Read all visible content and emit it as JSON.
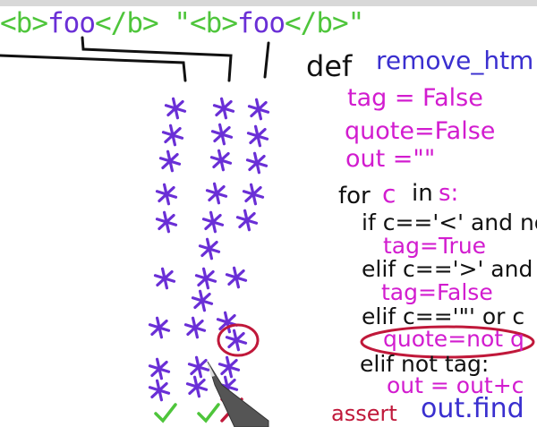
{
  "top_html": {
    "open1": "<b>",
    "text1": "foo",
    "close1": "</b>",
    "quote_open": "\"",
    "open2": "<b>",
    "text2": "foo",
    "close2": "</b>",
    "quote_close": "\""
  },
  "code": {
    "def_kw": "def",
    "fn_name": "remove_htm",
    "tag_line": "tag = False",
    "quote_line": "quote=False",
    "out_line": "out =\"\"",
    "for_kw": "for",
    "for_var": "c",
    "for_in": "in",
    "for_s": "s:",
    "if1": "if c=='<' and not",
    "tag_true": "tag=True",
    "elif2": "elif c=='>' and n",
    "tag_false": "tag=False",
    "elif3": "elif c=='\"' or c",
    "quote_not": "quote=not q",
    "elif4": "elif not tag:",
    "out_plus": "out = out+c",
    "assert_kw": "assert",
    "assert_expr": "out.find"
  },
  "annotations": {
    "asterisk": "*",
    "check": "✓",
    "cross": "✗"
  },
  "colors": {
    "green": "#4ec53b",
    "purple": "#6a2fd6",
    "pink": "#d21ccf",
    "red": "#c0183a",
    "black": "#111111"
  }
}
